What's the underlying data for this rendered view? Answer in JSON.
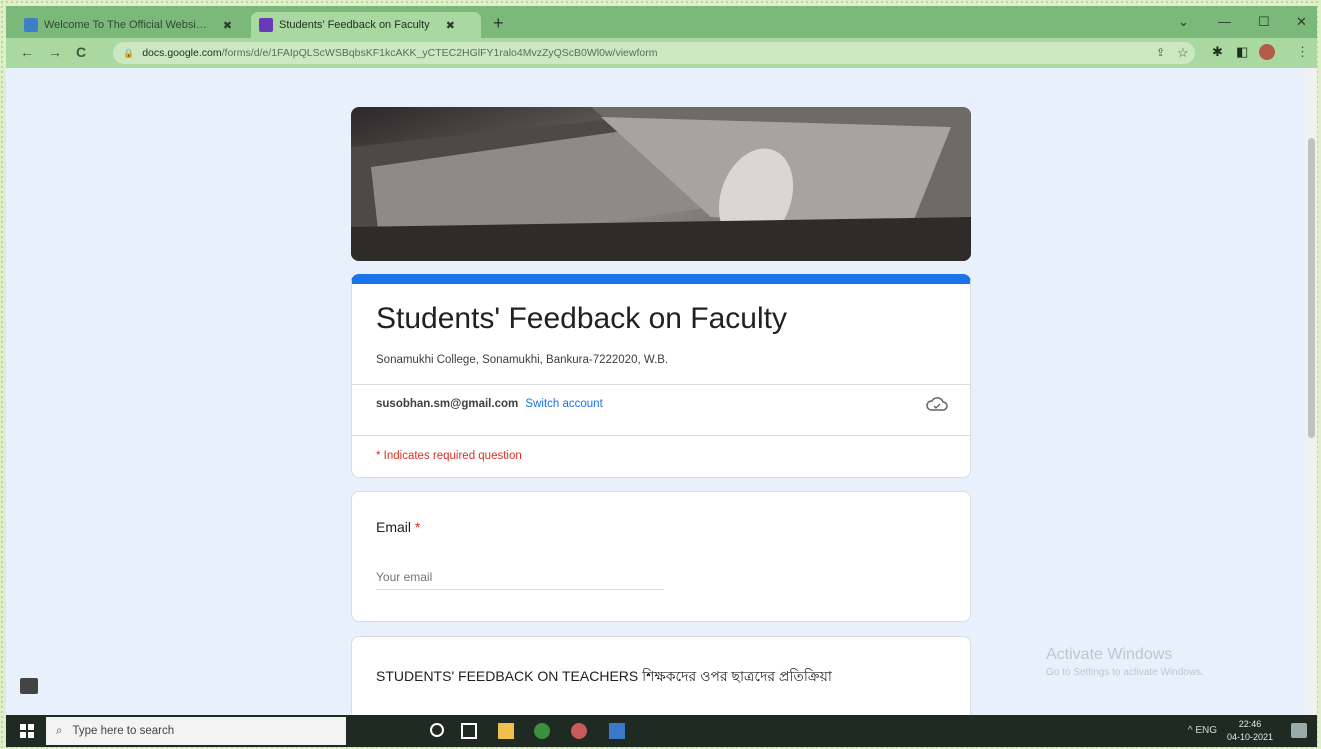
{
  "browser": {
    "tabs": [
      {
        "label": "Welcome To The Official Websi…",
        "active": false
      },
      {
        "label": "Students' Feedback on Faculty",
        "active": true
      }
    ],
    "new_tab": "+",
    "window_controls": {
      "minimize": "—",
      "maximize": "☐",
      "close": "✕",
      "menu": "⌄"
    },
    "nav": {
      "back": "←",
      "forward": "→",
      "reload": "C"
    },
    "url_host": "docs.google.com",
    "url_path": "/forms/d/e/1FAIpQLScWSBqbsKF1kcAKK_yCTEC2HGlFY1ralo4MvzZyQScB0Wl0w/viewform"
  },
  "form": {
    "title": "Students' Feedback on Faculty",
    "description": "Sonamukhi College, Sonamukhi, Bankura-7222020, W.B.",
    "account_email": "susobhan.sm@gmail.com",
    "switch_account": "Switch account",
    "required_note": "* Indicates required question",
    "email_question": {
      "label": "Email",
      "required_mark": "*",
      "placeholder": "Your email"
    },
    "section_title": "STUDENTS' FEEDBACK ON TEACHERS শিক্ষকদের ওপর ছাত্রদের প্রতিক্রিয়া"
  },
  "watermark": {
    "line1": "Activate Windows",
    "line2": "Go to Settings to activate Windows."
  },
  "taskbar": {
    "search_placeholder": "Type here to search",
    "tray_text": "^ ENG",
    "time": "22:46",
    "date": "04-10-2021"
  }
}
